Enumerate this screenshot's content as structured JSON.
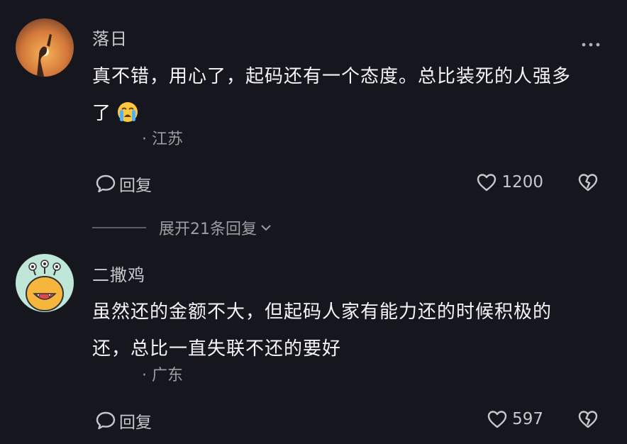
{
  "comments": [
    {
      "username": "落日",
      "text_line1": "真不错，用心了，起码还有一个态度。总比装死的人强多",
      "text_line2": "了",
      "emoji": "crying-face",
      "location": "· 江苏",
      "reply_label": "回复",
      "likes": "1200"
    },
    {
      "username": "二撒鸡",
      "text_line1": "虽然还的金额不大，但起码人家有能力还的时候积极的",
      "text_line2": "还，总比一直失联不还的要好",
      "location": "· 广东",
      "reply_label": "回复",
      "likes": "597"
    }
  ],
  "expand_replies": "展开21条回复",
  "icons": {
    "more": "more-dots-icon",
    "reply": "chat-bubble-icon",
    "like": "heart-outline-icon",
    "dislike": "broken-heart-icon",
    "expand": "chevron-down-icon"
  },
  "colors": {
    "background": "#16161e",
    "primary_text": "#f5f5f7",
    "secondary_text": "#9d9ea4"
  }
}
